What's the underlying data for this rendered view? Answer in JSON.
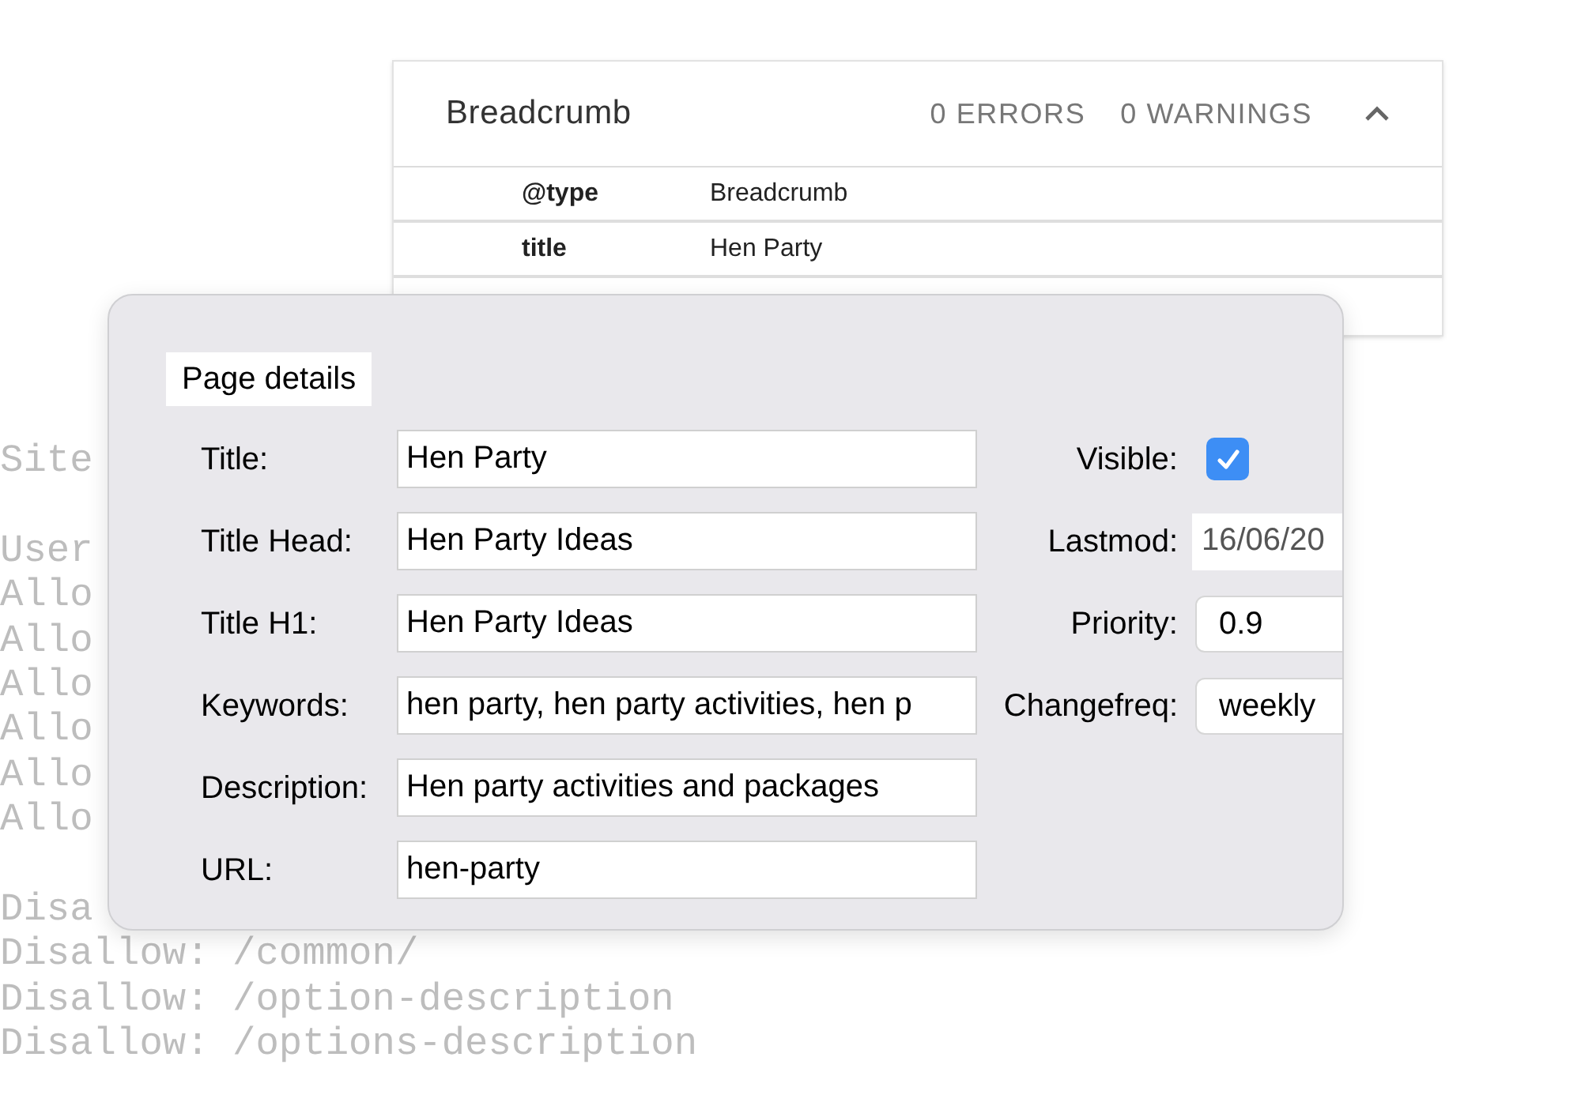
{
  "robots_text": {
    "blocks": [
      [
        "Site"
      ],
      [
        "User",
        "Allo",
        "Allo",
        "Allo",
        "Allo",
        "Allo",
        "Allo"
      ],
      [
        "Disa",
        "Disallow: /common/",
        "Disallow: /option-description",
        "Disallow: /options-description"
      ]
    ]
  },
  "breadcrumb_card": {
    "title": "Breadcrumb",
    "errors": "0 ERRORS",
    "warnings": "0 WARNINGS",
    "expanded": true,
    "rows": [
      {
        "name": "@type",
        "value": "Breadcrumb"
      },
      {
        "name": "title",
        "value": "Hen Party"
      }
    ]
  },
  "page_details": {
    "legend": "Page details",
    "fields": [
      {
        "label": "Title:",
        "value": "Hen Party"
      },
      {
        "label": "Title Head:",
        "value": "Hen Party Ideas"
      },
      {
        "label": "Title H1:",
        "value": "Hen Party Ideas"
      },
      {
        "label": "Keywords:",
        "value": "hen party, hen party activities, hen p"
      },
      {
        "label": "Description:",
        "value": "Hen party activities and packages"
      },
      {
        "label": "URL:",
        "value": "hen-party"
      }
    ],
    "side_fields": [
      {
        "kind": "checkbox",
        "label": "Visible:",
        "checked": true
      },
      {
        "kind": "date",
        "label": "Lastmod:",
        "value": "16/06/20"
      },
      {
        "kind": "select",
        "label": "Priority:",
        "value": "0.9"
      },
      {
        "kind": "select",
        "label": "Changefreq:",
        "value": "weekly"
      }
    ]
  }
}
